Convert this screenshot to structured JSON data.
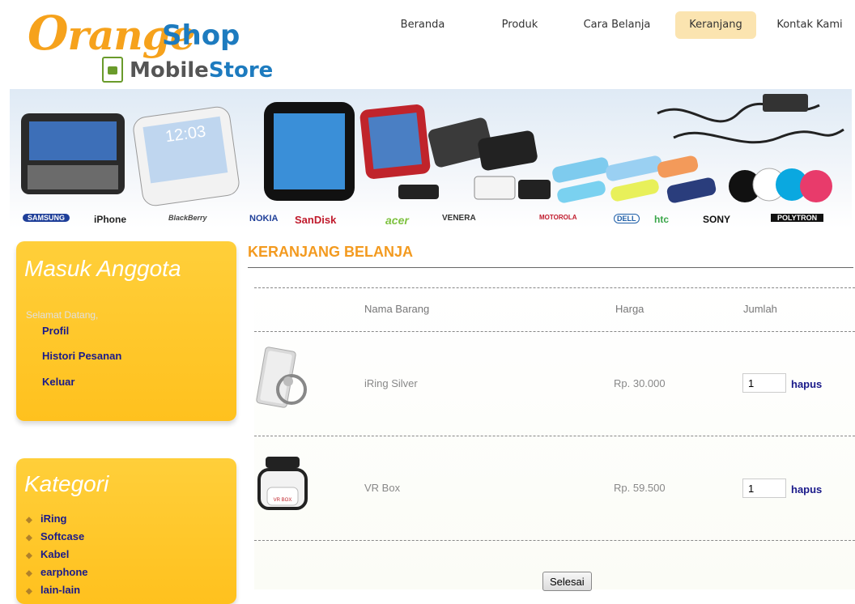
{
  "logo": {
    "brand_main": "Orange",
    "brand_shop": "Shop",
    "sub_mobile": "Mobile",
    "sub_store": "Store"
  },
  "nav": {
    "items": [
      "Beranda",
      "Produk",
      "Cara Belanja",
      "Keranjang",
      "Kontak Kami"
    ],
    "active": "Keranjang"
  },
  "banner": {
    "phone_time": "12:03",
    "brands": [
      "SAMSUNG",
      "iPhone",
      "BlackBerry",
      "NOKIA",
      "SanDisk",
      "acer",
      "VENERA",
      "MOTOROLA",
      "DELL",
      "htc",
      "SONY",
      "POLYTRON"
    ]
  },
  "sidebar": {
    "member": {
      "title": "Masuk Anggota",
      "welcome": "Selamat Datang,",
      "links": [
        "Profil",
        "Histori Pesanan",
        "Keluar"
      ]
    },
    "categories": {
      "title": "Kategori",
      "items": [
        "iRing",
        "Softcase",
        "Kabel",
        "earphone",
        "lain-lain"
      ]
    }
  },
  "cart": {
    "title": "KERANJANG BELANJA",
    "headers": {
      "name": "Nama Barang",
      "price": "Harga",
      "qty": "Jumlah"
    },
    "rows": [
      {
        "image": "iring-silver-image",
        "name": "iRing Silver",
        "price": "Rp. 30.000",
        "qty": "1",
        "remove": "hapus"
      },
      {
        "image": "vr-box-image",
        "name": "VR Box",
        "price": "Rp. 59.500",
        "qty": "1",
        "remove": "hapus"
      }
    ],
    "vr_label": "VR BOX",
    "finish_button": "Selesai"
  },
  "colors": {
    "accent_orange": "#f39a1f",
    "panel_yellow": "#ffc82a",
    "link_navy": "#1a1a8a",
    "brand_blue": "#1d7bbf"
  }
}
